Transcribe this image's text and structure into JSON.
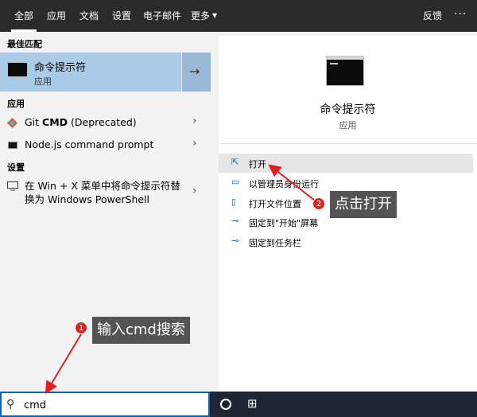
{
  "nav": {
    "tabs": [
      "全部",
      "应用",
      "文档",
      "设置",
      "电子邮件",
      "更多"
    ],
    "feedback": "反馈",
    "more_dots": "···"
  },
  "left": {
    "best_match_heading": "最佳匹配",
    "best_match": {
      "title": "命令提示符",
      "subtitle": "应用"
    },
    "apps_heading": "应用",
    "apps": [
      {
        "label_plain": "Git ",
        "label_bold": "CMD",
        "label_tail": " (Deprecated)"
      },
      {
        "label": "Node.js command prompt"
      }
    ],
    "settings_heading": "设置",
    "settings_item": {
      "line1": "在 Win + X 菜单中将命令提示符替",
      "line2": "换为 Windows PowerShell"
    }
  },
  "preview": {
    "title": "命令提示符",
    "subtitle": "应用",
    "actions": [
      {
        "label": "打开",
        "icon": "open-icon"
      },
      {
        "label": "以管理员身份运行",
        "icon": "admin-shield-icon"
      },
      {
        "label": "打开文件位置",
        "icon": "file-location-icon"
      },
      {
        "label": "固定到\"开始\"屏幕",
        "icon": "pin-icon"
      },
      {
        "label": "固定到任务栏",
        "icon": "pin-icon"
      }
    ]
  },
  "taskbar": {
    "search_value": "cmd"
  },
  "annotations": {
    "step1_badge": "1",
    "step1_text": "输入cmd搜索",
    "step2_badge": "2",
    "step2_text": "点击打开"
  },
  "colors": {
    "nav_bg": "#2b2b2b",
    "highlight": "#a9cbe7",
    "taskbar_bg": "#1f2633",
    "accent": "#0063b1",
    "badge_red": "#e02020"
  }
}
